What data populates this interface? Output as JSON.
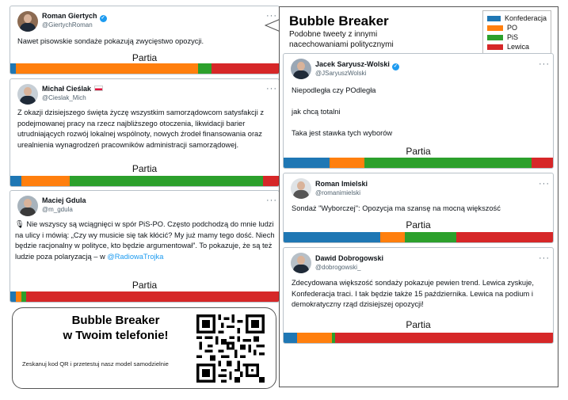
{
  "colors": {
    "konfederacja": "#1f77b4",
    "po": "#ff7f0e",
    "pis": "#2ca02c",
    "lewica": "#d62728"
  },
  "partia_label": "Partia",
  "more_label": "···",
  "verified_mark": "✓",
  "left_tweets": [
    {
      "name": "Roman Giertych",
      "handle": "@GiertychRoman",
      "verified": true,
      "flag": false,
      "text": [
        "Nawet pisowskie sondaże pokazują zwycięstwo opozycji."
      ],
      "bar": [
        0.02,
        0.68,
        0.05,
        0.25
      ]
    },
    {
      "name": "Michał Cieślak",
      "handle": "@Cieslak_Mich",
      "verified": false,
      "flag": true,
      "text": [
        "Z okazji dzisiejszego święta życzę wszystkim samorządowcom satysfakcji z podejmowanej pracy na rzecz najbliższego otoczenia, likwidacji barier utrudniających rozwój lokalnej wspólnoty, nowych źrodeł finansowania oraz urealnienia wynagrodzeń pracowników administracji samorządowej."
      ],
      "bar": [
        0.04,
        0.18,
        0.72,
        0.06
      ]
    },
    {
      "name": "Maciej Gdula",
      "handle": "@m_gdula",
      "verified": false,
      "flag": false,
      "text": [
        "🎙 Nie wszyscy są wciągnięci w spór PiS-PO. Często podchodzą do mnie ludzi na ulicy i mówią: „Czy wy musicie się tak kłócić? My już mamy tego dość. Niech będzie racjonalny w polityce, kto będzie argumentował”. To pokazuje, że są też ludzie poza polaryzacją – w "
      ],
      "link": "@RadiowaTrojka",
      "bar": [
        0.02,
        0.02,
        0.02,
        0.94
      ]
    }
  ],
  "qr": {
    "title_line1": "Bubble Breaker",
    "title_line2": "w Twoim telefonie!",
    "subtitle": "Zeskanuj kod QR i przetestuj nasz model samodzielnie"
  },
  "bubble": {
    "title": "Bubble Breaker",
    "subtitle": "Podobne tweety z innymi nacechowaniami politycznymi",
    "legend": [
      {
        "label": "Konfederacja",
        "color": "#1f77b4"
      },
      {
        "label": "PO",
        "color": "#ff7f0e"
      },
      {
        "label": "PiS",
        "color": "#2ca02c"
      },
      {
        "label": "Lewica",
        "color": "#d62728"
      }
    ],
    "tweets": [
      {
        "name": "Jacek Saryusz-Wolski",
        "handle": "@JSaryuszWolski",
        "verified": true,
        "text": [
          "Niepodległa  czy  POdległa",
          "",
          "jak chcą totalni",
          "",
          "Taka jest stawka tych wyborów"
        ],
        "bar": [
          0.17,
          0.13,
          0.62,
          0.08
        ]
      },
      {
        "name": "Roman Imielski",
        "handle": "@romanimielski",
        "verified": false,
        "text": [
          "Sondaż \"Wyborczej\": Opozycja ma szansę na mocną większość"
        ],
        "bar": [
          0.36,
          0.09,
          0.19,
          0.36
        ]
      },
      {
        "name": "Dawid Dobrogowski",
        "handle": "@dobrogowski_",
        "verified": false,
        "text": [
          "Zdecydowana większość sondaży pokazuje pewien trend. Lewica zyskuje, Konfederacja traci. I tak będzie także 15 października. Lewica na podium i demokratyczny rząd dzisiejszej opozycji!"
        ],
        "bar": [
          0.05,
          0.13,
          0.01,
          0.81
        ]
      }
    ]
  }
}
